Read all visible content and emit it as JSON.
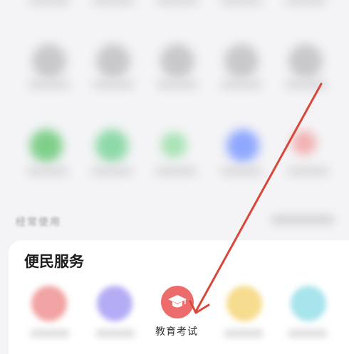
{
  "section_often_used": "经常使用",
  "card": {
    "title": "便民服务",
    "highlighted_service": {
      "label": "教育考试",
      "icon": "graduation-cap-icon",
      "color": "#ec6b6b"
    }
  },
  "colors": {
    "background": "#f4f4f6",
    "card": "#ffffff",
    "annotation_arrow": "#d9473a"
  }
}
